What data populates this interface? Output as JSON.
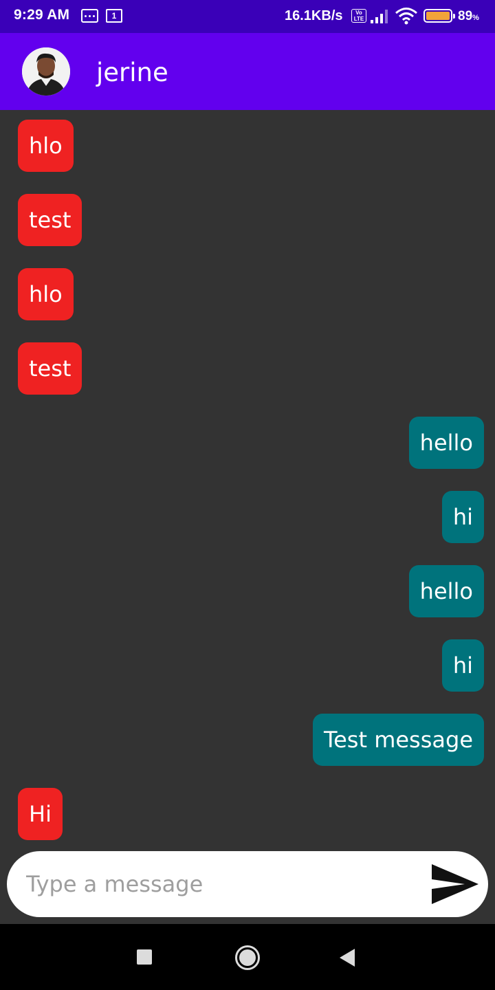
{
  "status_bar": {
    "time": "9:29 AM",
    "sim_slot": "1",
    "net_speed": "16.1KB/s",
    "volte_top": "Vo",
    "volte_bottom": "LTE",
    "battery_level": "89",
    "battery_unit": "%",
    "battery_fraction": 0.89,
    "icons": [
      "message-notification-icon",
      "sim-icon",
      "volte-icon",
      "signal-icon",
      "wifi-icon",
      "battery-icon"
    ]
  },
  "header": {
    "contact_name": "jerine",
    "background": "#6200ee",
    "status_bar_background": "#3a00b8"
  },
  "messages": [
    {
      "text": "hlo",
      "direction": "incoming"
    },
    {
      "text": "test",
      "direction": "incoming"
    },
    {
      "text": "hlo",
      "direction": "incoming"
    },
    {
      "text": "test",
      "direction": "incoming"
    },
    {
      "text": "hello",
      "direction": "outgoing"
    },
    {
      "text": "hi",
      "direction": "outgoing"
    },
    {
      "text": "hello",
      "direction": "outgoing"
    },
    {
      "text": "hi",
      "direction": "outgoing"
    },
    {
      "text": "Test message",
      "direction": "outgoing"
    },
    {
      "text": "Hi",
      "direction": "incoming"
    }
  ],
  "colors": {
    "incoming_bubble": "#ef2222",
    "outgoing_bubble": "#00737c",
    "chat_background": "#333333"
  },
  "composer": {
    "placeholder": "Type a message",
    "value": "",
    "send_icon": "send-icon"
  },
  "nav_bar": {
    "icons": [
      "recents-icon",
      "home-icon",
      "back-icon"
    ]
  }
}
